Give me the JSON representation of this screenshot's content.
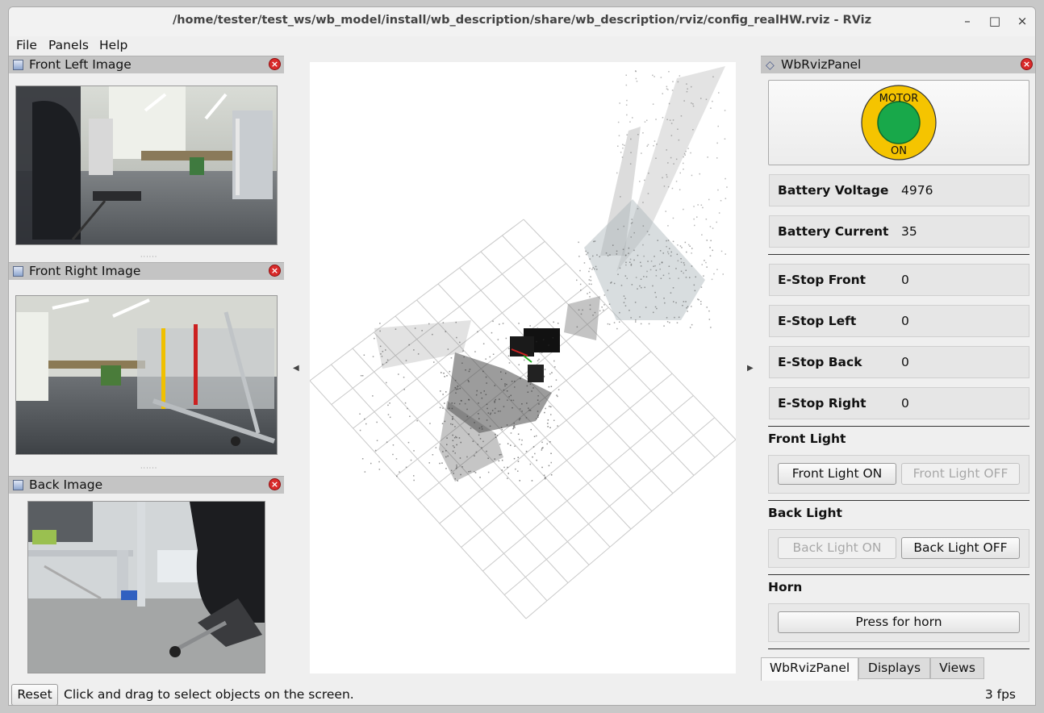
{
  "window": {
    "title": "/home/tester/test_ws/wb_model/install/wb_description/share/wb_description/rviz/config_realHW.rviz - RViz",
    "controls": {
      "minimize": "–",
      "maximize": "□",
      "close": "×"
    }
  },
  "menubar": {
    "items": [
      "File",
      "Panels",
      "Help"
    ]
  },
  "left_panels": [
    {
      "title": "Front Left Image"
    },
    {
      "title": "Front Right Image"
    },
    {
      "title": "Back Image"
    }
  ],
  "right_panel": {
    "title": "WbRvizPanel",
    "motor_button": {
      "top": "MOTOR",
      "bottom": "ON",
      "ring_color": "#f5c400",
      "center_color": "#18a84a"
    },
    "battery": [
      {
        "label": "Battery Voltage",
        "value": "4976"
      },
      {
        "label": "Battery Current",
        "value": "35"
      }
    ],
    "estops": [
      {
        "label": "E-Stop Front",
        "value": "0"
      },
      {
        "label": "E-Stop Left",
        "value": "0"
      },
      {
        "label": "E-Stop Back",
        "value": "0"
      },
      {
        "label": "E-Stop Right",
        "value": "0"
      }
    ],
    "front_light": {
      "title": "Front Light",
      "on": "Front Light ON",
      "off": "Front Light OFF"
    },
    "back_light": {
      "title": "Back Light",
      "on": "Back Light ON",
      "off": "Back Light OFF"
    },
    "horn": {
      "title": "Horn",
      "button": "Press for horn"
    }
  },
  "tabs": [
    "WbRvizPanel",
    "Displays",
    "Views"
  ],
  "statusbar": {
    "reset": "Reset",
    "message": "Click and drag to select objects on the screen.",
    "fps": "3 fps"
  }
}
